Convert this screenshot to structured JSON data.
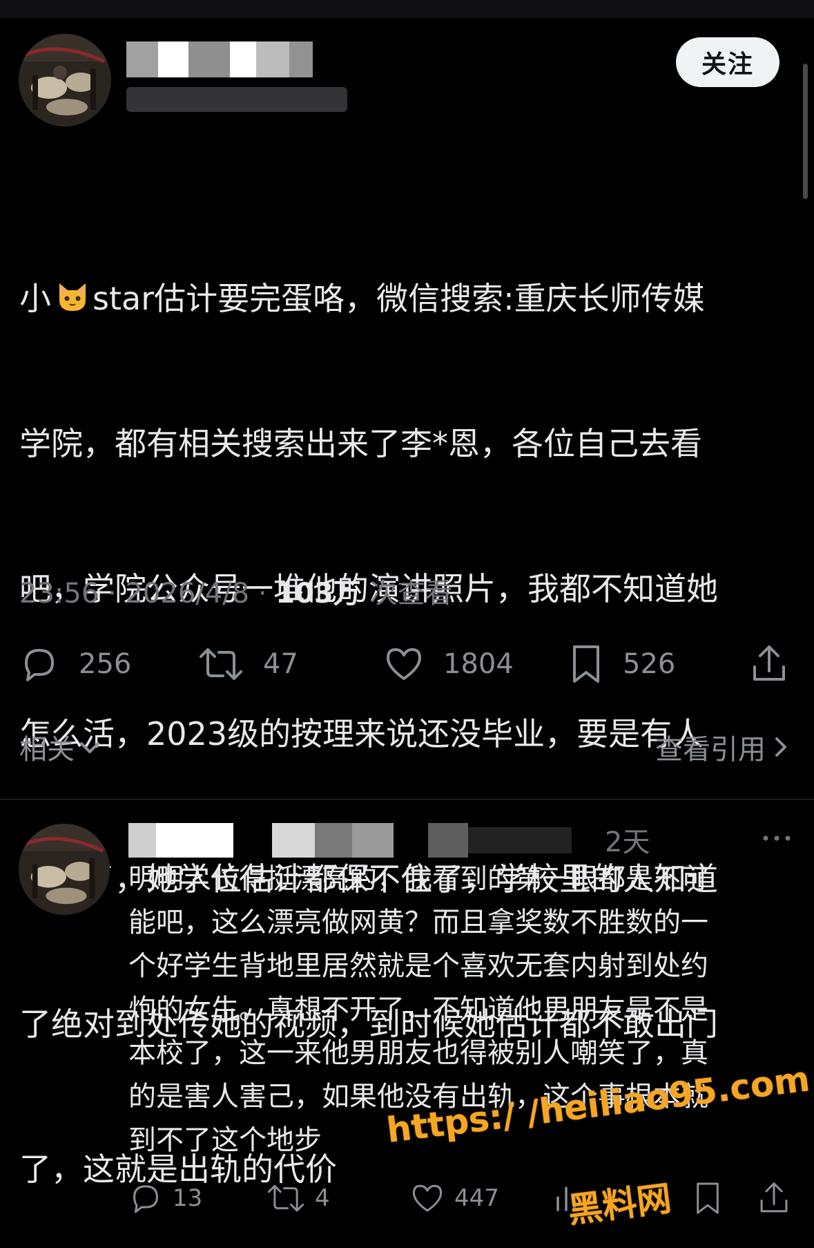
{
  "follow_button": {
    "label": "关注"
  },
  "tweet": {
    "text_lines": [
      [
        "小",
        "star估计要完蛋咯，微信搜索:重庆长师传媒"
      ],
      "学院，都有相关搜索出来了李*恩，各位自己去看",
      "吧，学院公众号一堆他的演讲照片，我都不知道她",
      "怎么活，2023级的按理来说还没毕业，要是有人",
      "举报了，她学位估计都保不住了，学校里的人知道",
      "了绝对到处传她的视频，到时候她估计都不敢出门",
      "了，这就是出轨的代价"
    ],
    "time": "23:56",
    "date": "2026/4/8",
    "separator": "·",
    "views_count": "103万",
    "views_label": "次查看",
    "actions": {
      "reply": "256",
      "retweet": "47",
      "like": "1804",
      "bookmark": "526"
    }
  },
  "related": {
    "label": "相关"
  },
  "view_quotes": {
    "label": "查看引用"
  },
  "reply": {
    "time": "2天",
    "text_lines": [
      "明明人长得挺漂亮的，我看到的第一眼都是不可",
      "能吧，这么漂亮做网黄？而且拿奖数不胜数的一",
      "个好学生背地里居然就是个喜欢无套内射到处约",
      "炮的女生。真想不开了，不知道他男朋友是不是",
      "本校了，这一来他男朋友也得被别人嘲笑了，真",
      "的是害人害己，如果他没有出轨，这个事根本就",
      "到不了这个地步"
    ],
    "actions": {
      "reply": "13",
      "retweet": "4",
      "like": "447"
    }
  },
  "watermark": {
    "url": "https:/ /heiliao95.com",
    "name": "黑料网"
  },
  "colors": {
    "background": "#000000",
    "text": "#e7e9ea",
    "secondary": "#71767b",
    "watermark": "#f5a623"
  }
}
